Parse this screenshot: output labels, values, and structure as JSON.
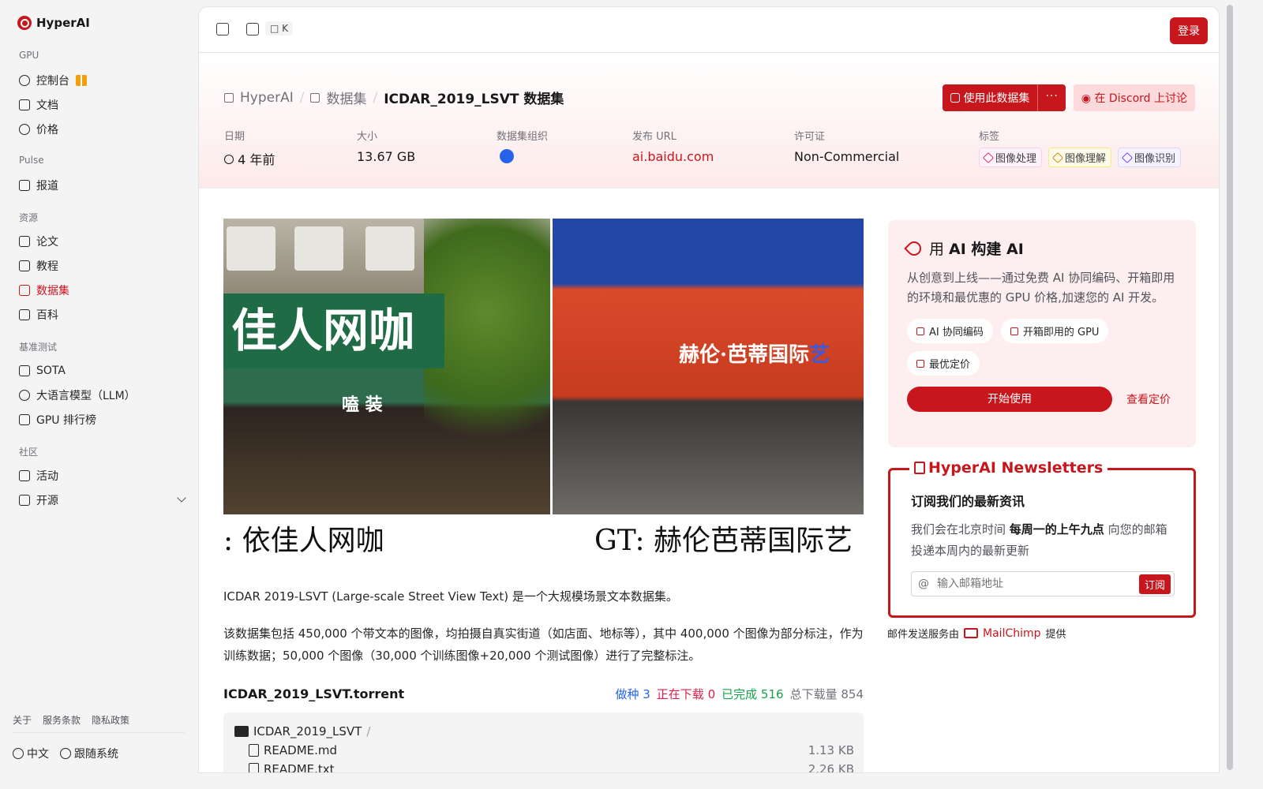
{
  "app": {
    "name": "HyperAI"
  },
  "sidebar": {
    "sections": [
      {
        "title": "GPU",
        "items": [
          {
            "label": "控制台",
            "icon": "dashboard-icon"
          },
          {
            "label": "文档",
            "icon": "document-icon"
          },
          {
            "label": "价格",
            "icon": "price-icon"
          }
        ]
      },
      {
        "title": "Pulse",
        "items": [
          {
            "label": "报道",
            "icon": "news-icon"
          }
        ]
      },
      {
        "title": "资源",
        "items": [
          {
            "label": "论文",
            "icon": "paper-icon"
          },
          {
            "label": "教程",
            "icon": "tutorial-icon"
          },
          {
            "label": "数据集",
            "icon": "database-icon",
            "active": true
          },
          {
            "label": "百科",
            "icon": "wiki-icon"
          }
        ]
      },
      {
        "title": "基准测试",
        "items": [
          {
            "label": "SOTA",
            "icon": "chart-icon"
          },
          {
            "label": "大语言模型（LLM）",
            "icon": "llm-icon"
          },
          {
            "label": "GPU 排行榜",
            "icon": "monitor-icon"
          }
        ]
      },
      {
        "title": "社区",
        "items": [
          {
            "label": "活动",
            "icon": "calendar-icon"
          },
          {
            "label": "开源",
            "icon": "opensource-icon"
          }
        ]
      }
    ],
    "footer_links": [
      "关于",
      "服务条款",
      "隐私政策"
    ],
    "language": "中文",
    "theme": "跟随系统"
  },
  "topbar": {
    "shortcut": "K",
    "login": "登录"
  },
  "header": {
    "breadcrumb": [
      "HyperAI",
      "数据集",
      "ICDAR_2019_LSVT 数据集"
    ],
    "use_dataset": "使用此数据集",
    "more": "···",
    "discord": "在 Discord 上讨论",
    "meta": {
      "date_label": "日期",
      "date_value": "4 年前",
      "size_label": "大小",
      "size_value": "13.67 GB",
      "org_label": "数据集组织",
      "url_label": "发布 URL",
      "url_value": "ai.baidu.com",
      "license_label": "许可证",
      "license_value": "Non-Commercial",
      "tags_label": "标签",
      "tags": [
        "图像处理",
        "图像理解",
        "图像识别"
      ]
    }
  },
  "hero": {
    "left_sign": "佳人网咖",
    "left_sub": "嗑 装",
    "right_sign": "赫伦·芭蒂国际",
    "right_sign_accent": "艺",
    "caption_left": ": 依佳人网咖",
    "caption_right": "GT: 赫伦芭蒂国际艺"
  },
  "content": {
    "desc1": "ICDAR 2019-LSVT (Large-scale Street View Text) 是一个大规模场景文本数据集。",
    "desc2": "该数据集包括 450,000 个带文本的图像，均拍摄自真实街道（如店面、地标等），其中 400,000 个图像为部分标注，作为训练数据；50,000 个图像（30,000 个训练图像+20,000 个测试图像）进行了完整标注。",
    "torrent_name": "ICDAR_2019_LSVT.torrent",
    "stats": {
      "seed_label": "做种",
      "seed": "3",
      "downloading_label": "正在下载",
      "downloading": "0",
      "done_label": "已完成",
      "done": "516",
      "total_label": "总下载量",
      "total": "854"
    },
    "files": [
      {
        "name": "ICDAR_2019_LSVT",
        "type": "folder",
        "size": ""
      },
      {
        "name": "README.md",
        "type": "file",
        "size": "1.13 KB"
      },
      {
        "name": "README.txt",
        "type": "file",
        "size": "2.26 KB"
      }
    ]
  },
  "promo": {
    "title_prefix": "用",
    "title": "AI 构建 AI",
    "desc": "从创意到上线——通过免费 AI 协同编码、开箱即用的环境和最优惠的 GPU 价格,加速您的 AI 开发。",
    "chips": [
      "AI 协同编码",
      "开箱即用的 GPU",
      "最优定价"
    ],
    "start": "开始使用",
    "pricing": "查看定价"
  },
  "newsletter": {
    "title": "HyperAI Newsletters",
    "subtitle": "订阅我们的最新资讯",
    "desc_pre": "我们会在北京时间 ",
    "desc_bold": "每周一的上午九点",
    "desc_post": " 向您的邮箱投递本周内的最新更新",
    "placeholder": "输入邮箱地址",
    "subscribe": "订阅",
    "provided_pre": "邮件发送服务由",
    "provider": "MailChimp",
    "provided_post": "提供"
  },
  "colors": {
    "brand": "#c8161d"
  }
}
